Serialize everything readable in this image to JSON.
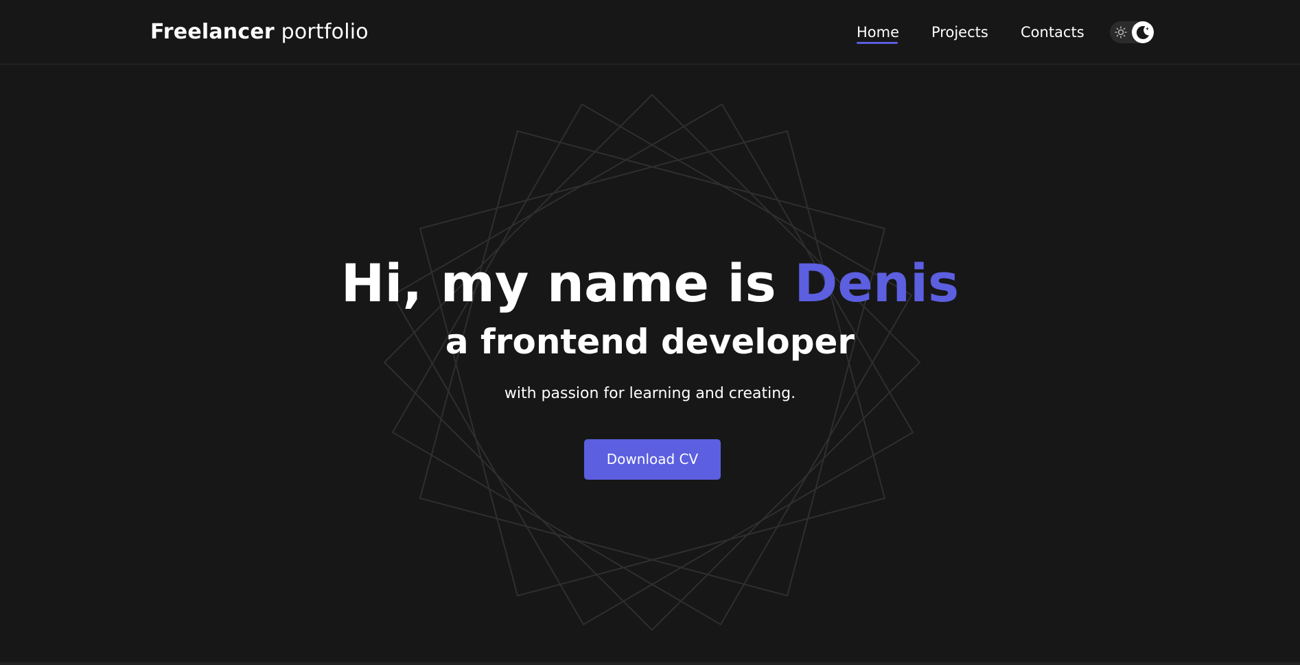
{
  "header": {
    "logo_bold": "Freelancer",
    "logo_light": "portfolio",
    "nav": [
      {
        "label": "Home",
        "active": true
      },
      {
        "label": "Projects",
        "active": false
      },
      {
        "label": "Contacts",
        "active": false
      }
    ],
    "theme_toggle": {
      "icons": [
        "sun-icon",
        "moon-icon"
      ],
      "selected": "moon-icon"
    }
  },
  "hero": {
    "title_prefix": "Hi, my name is",
    "title_name": "Denis",
    "subtitle": "a frontend developer",
    "tagline": "with passion for learning and creating.",
    "cta_label": "Download CV"
  },
  "colors": {
    "background": "#171717",
    "accent": "#5c5fe0",
    "text": "#ffffff"
  }
}
